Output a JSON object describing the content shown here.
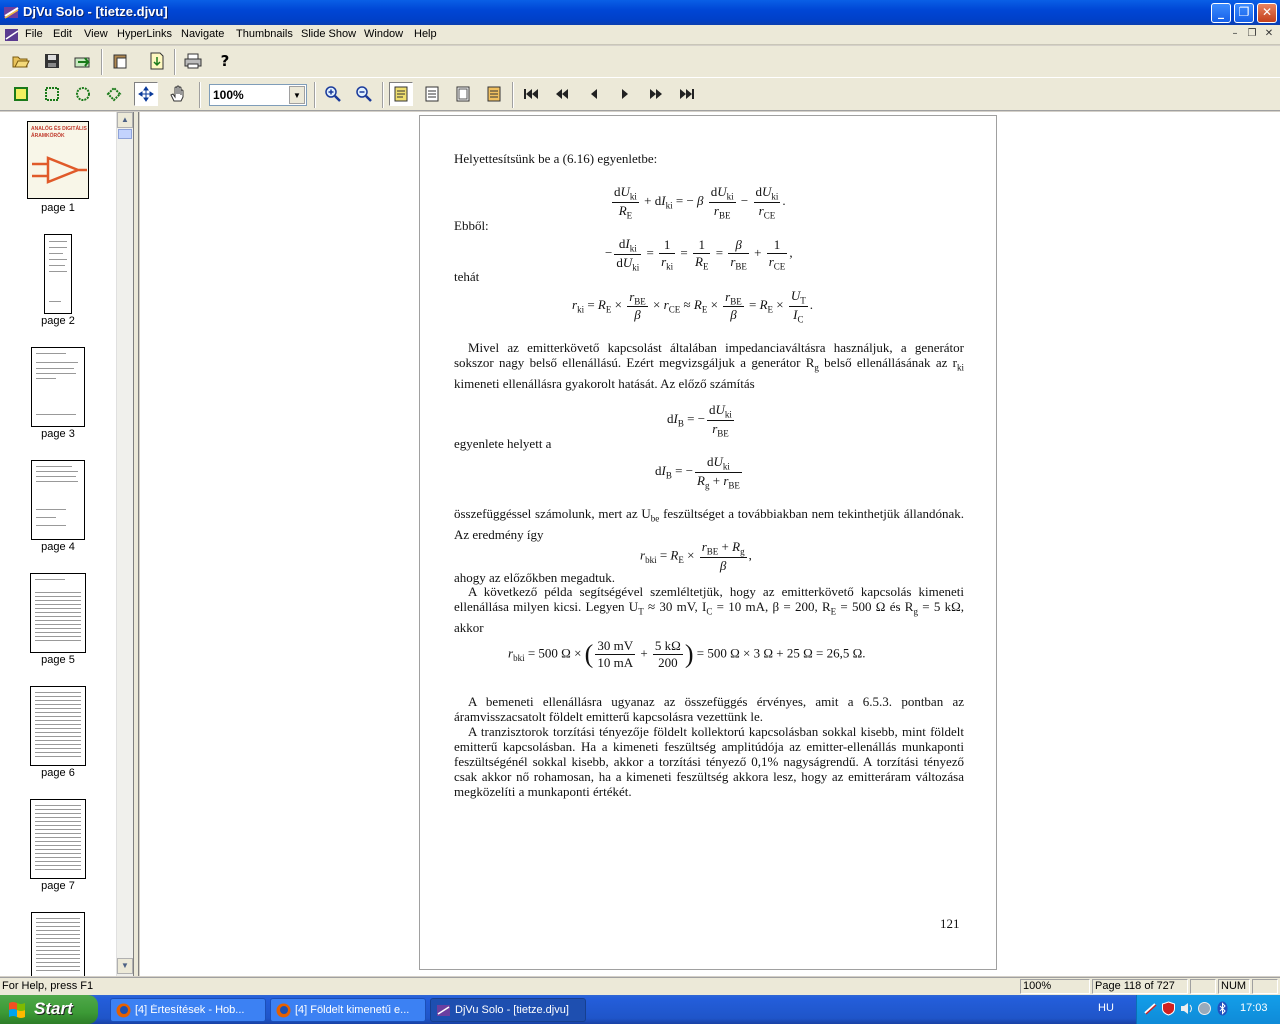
{
  "window": {
    "title": "DjVu Solo - [tietze.djvu]"
  },
  "menu": [
    "File",
    "Edit",
    "View",
    "HyperLinks",
    "Navigate",
    "Thumbnails",
    "Slide Show",
    "Window",
    "Help"
  ],
  "toolbar1": [
    "open-icon",
    "save-icon",
    "export-icon",
    "paste-icon",
    "import-icon",
    "print-icon",
    "help-icon"
  ],
  "toolbar2": {
    "zoom_value": "100%",
    "tools": [
      "select-page-icon",
      "select-rect-icon",
      "select-ellipse-icon",
      "select-shape-icon",
      "move-icon",
      "hand-icon"
    ],
    "zoom_buttons": [
      "zoom-in-icon",
      "zoom-out-icon"
    ],
    "view_buttons": [
      "single-page-icon",
      "fit-width-icon",
      "fit-page-icon",
      "continuous-icon"
    ],
    "nav_buttons": [
      "first-page-icon",
      "back-icon",
      "prev-page-icon",
      "next-page-icon",
      "forward-icon",
      "last-page-icon"
    ]
  },
  "thumbnails": {
    "pages": [
      "page 1",
      "page 2",
      "page 3",
      "page 4",
      "page 5",
      "page 6",
      "page 7"
    ],
    "cover_text": "ANALÓG ÉS DIGITÁLIS ÁRAMKÖRÖK"
  },
  "document": {
    "lines": {
      "l1": "Helyettesítsünk be a (6.16) egyenletbe:",
      "l2": "Ebből:",
      "l3": "tehát",
      "p1": "Mivel az emitterkövető kapcsolást általában impedanciaváltásra használjuk, a generátor sokszor nagy belső ellenállású. Ezért megvizsgáljuk a generátor R",
      "p1_sub": "g",
      "p1b": " belső ellenállásának az r",
      "p1b_sub": "ki",
      "p1c": " kimeneti ellenállásra gyakorolt hatását. Az előző számítás",
      "l4": "egyenlete helyett a",
      "p2a": "összefüggéssel számolunk, mert az U",
      "p2_sub": "be",
      "p2b": " feszültséget a továbbiakban nem tekinthetjük állandónak. Az eredmény így",
      "l5": "ahogy az előzőkben megadtuk.",
      "p3": "A következő példa segítségével szemléltetjük, hogy az emitterkövető kapcsolás kimeneti ellenállása milyen kicsi. Legyen U",
      "p3_sub1": "T",
      "p3b": " ≈ 30 mV, I",
      "p3_sub2": "C",
      "p3c": " = 10 mA, β = 200, R",
      "p3_sub3": "E",
      "p3d": " = 500 Ω és R",
      "p3_sub4": "g",
      "p3e": " = 5 kΩ, akkor",
      "p4": "A bemeneti ellenállásra ugyanaz az összefüggés érvényes, amit a 6.5.3. pontban az áramvisszacsatolt földelt emitterű kapcsolásra vezettünk le.",
      "p5": "A tranzisztorok torzítási tényezője földelt kollektorú kapcsolásban sokkal kisebb, mint földelt emitterű kapcsolásban. Ha a kimeneti feszültség amplitúdója az emitter-ellenállás munkaponti feszültségénél sokkal kisebb, akkor a torzítási tényező 0,1% nagyságrendű. A torzítási tényező csak akkor nő rohamosan, ha a kimeneti feszültség akkora lesz, hogy az emitteráram változása megközelíti a munkaponti értékét."
    },
    "eq5_tail": "= 500 Ω × 3 Ω + 25 Ω = 26,5 Ω.",
    "page_number": "121"
  },
  "statusbar": {
    "help": "For Help, press F1",
    "zoom": "100%",
    "page": "Page 118 of 727",
    "num": "NUM"
  },
  "taskbar": {
    "start": "Start",
    "tasks": [
      "[4] Értesítések - Hob...",
      "[4] Földelt kimenetű e...",
      "DjVu Solo - [tietze.djvu]"
    ],
    "lang": "HU",
    "clock": "17:03"
  }
}
